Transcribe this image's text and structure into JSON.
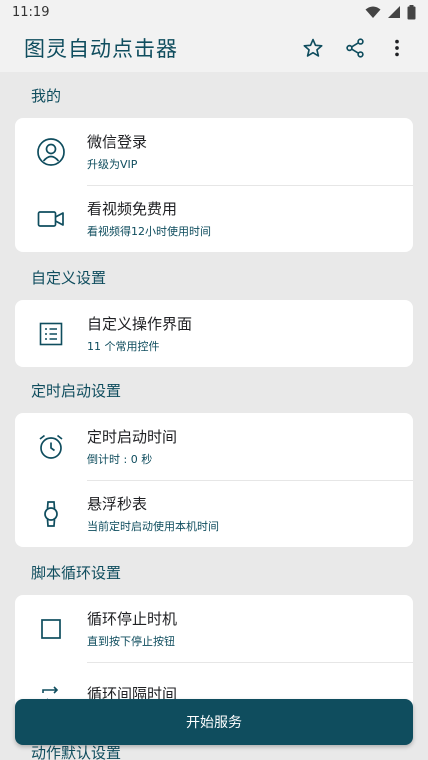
{
  "status": {
    "time": "11:19"
  },
  "app": {
    "title": "图灵自动点击器",
    "accent": "#0f4d5e"
  },
  "sections": [
    {
      "header": "我的",
      "items": [
        {
          "title": "微信登录",
          "sub": "升级为VIP"
        },
        {
          "title": "看视频免费用",
          "sub": "看视频得12小时使用时间"
        }
      ]
    },
    {
      "header": "自定义设置",
      "items": [
        {
          "title": "自定义操作界面",
          "sub": "11 个常用控件"
        }
      ]
    },
    {
      "header": "定时启动设置",
      "items": [
        {
          "title": "定时启动时间",
          "sub": "倒计时 : 0 秒"
        },
        {
          "title": "悬浮秒表",
          "sub": "当前定时启动使用本机时间"
        }
      ]
    },
    {
      "header": "脚本循环设置",
      "items": [
        {
          "title": "循环停止时机",
          "sub": "直到按下停止按钮"
        },
        {
          "title": "循环间隔时间",
          "sub": ""
        }
      ]
    },
    {
      "header": "动作默认设置",
      "items": []
    }
  ],
  "start_button": {
    "label": "开始服务"
  },
  "icons": {
    "wifi": "wifi-icon",
    "signal": "signal-icon",
    "battery": "battery-icon",
    "star": "star-icon",
    "share": "share-icon",
    "more": "more-vert-icon",
    "user": "user-circle-icon",
    "video": "video-camera-icon",
    "list": "list-icon",
    "alarm": "alarm-clock-icon",
    "watch": "watch-icon",
    "square": "square-icon",
    "repeat": "repeat-icon"
  }
}
